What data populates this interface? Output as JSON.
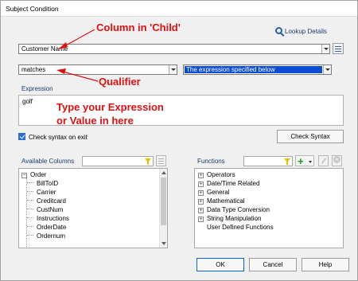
{
  "window": {
    "title": "Subject Condition"
  },
  "annotations": {
    "column": "Column in 'Child'",
    "qualifier": "Qualifier",
    "expression_line1": "Type your Expression",
    "expression_line2": "or Value in here"
  },
  "lookup": {
    "label": "Lookup Details",
    "icon": "search-icon"
  },
  "column_select": {
    "value": "Customer Name"
  },
  "qualifier_select": {
    "value": "matches"
  },
  "expression_mode_select": {
    "value": "The expression specified below"
  },
  "expression": {
    "label": "Expression",
    "value": "golf"
  },
  "check_on_exit": {
    "label": "Check syntax on exit",
    "checked": true
  },
  "check_syntax_button": "Check Syntax",
  "available_columns": {
    "label": "Available Columns",
    "root": "Order",
    "items": [
      "BillToID",
      "Carrier",
      "Creditcard",
      "CustNum",
      "Instructions",
      "OrderDate",
      "Ordernum"
    ]
  },
  "functions": {
    "label": "Functions",
    "items": [
      "Operators",
      "Date/Time Related",
      "General",
      "Mathematical",
      "Data Type Conversion",
      "String Manipulation",
      "User Defined Functions"
    ]
  },
  "buttons": {
    "ok": "OK",
    "cancel": "Cancel",
    "help": "Help"
  },
  "colors": {
    "accent": "#0a4cd6",
    "annotation": "#e01010",
    "label": "#1a3d6e",
    "add": "#1a9a1a",
    "filter": "#e8c000"
  }
}
